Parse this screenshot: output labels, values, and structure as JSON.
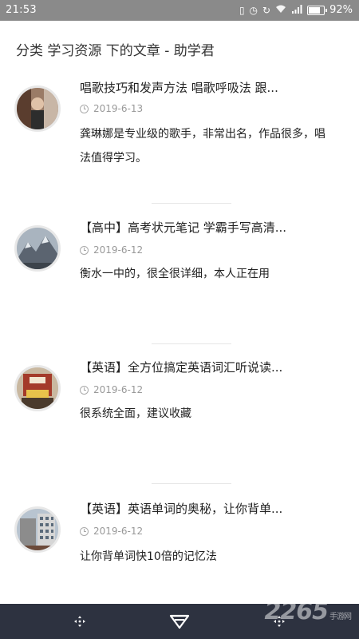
{
  "status_bar": {
    "time": "21:53",
    "battery": "92%"
  },
  "page": {
    "title": "分类 学习资源 下的文章 - 助学君"
  },
  "articles": [
    {
      "title": "唱歌技巧和发声方法 唱歌呼吸法 跟...",
      "date": "2019-6-13",
      "excerpt": "龚琳娜是专业级的歌手，非常出名，作品很多，唱法值得学习。"
    },
    {
      "title": "【高中】高考状元笔记 学霸手写高清...",
      "date": "2019-6-12",
      "excerpt": "衡水一中的，很全很详细，本人正在用"
    },
    {
      "title": "【英语】全方位搞定英语词汇听说读...",
      "date": "2019-6-12",
      "excerpt": "很系统全面，建议收藏"
    },
    {
      "title": "【英语】英语单词的奥秘，让你背单...",
      "date": "2019-6-12",
      "excerpt": "让你背单词快10倍的记忆法"
    }
  ],
  "bottom_nav": {
    "left_icon": "move-icon",
    "center_icon": "diamond-icon",
    "right_icon": "move-icon"
  },
  "watermark": {
    "text": "2265",
    "sub": "手游网"
  }
}
